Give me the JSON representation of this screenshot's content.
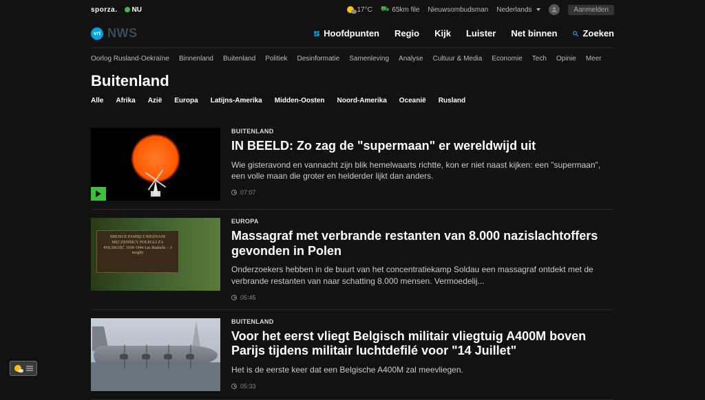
{
  "topbar": {
    "brand1": "sporza.",
    "brand2": "NU",
    "weather_temp": "17°C",
    "traffic": "65km file",
    "ombudsman": "Nieuwsombudsman",
    "language": "Nederlands",
    "login": "Aanmelden"
  },
  "logo": {
    "badge": "vrt",
    "text": "NWS"
  },
  "mainnav": [
    "Hoofdpunten",
    "Regio",
    "Kijk",
    "Luister",
    "Net binnen",
    "Zoeken"
  ],
  "categories": [
    "Oorlog Rusland-Oekraïne",
    "Binnenland",
    "Buitenland",
    "Politiek",
    "Desinformatie",
    "Samenleving",
    "Analyse",
    "Cultuur & Media",
    "Economie",
    "Tech",
    "Opinie",
    "Meer"
  ],
  "page_title": "Buitenland",
  "filters": [
    "Alle",
    "Afrika",
    "Azië",
    "Europa",
    "Latijns-Amerika",
    "Midden-Oosten",
    "Noord-Amerika",
    "Oceanië",
    "Rusland"
  ],
  "articles": [
    {
      "kicker": "BUITENLAND",
      "headline": "IN BEELD: Zo zag de \"supermaan\" er wereldwijd uit",
      "dek": "Wie gisteravond en vannacht zijn blik hemelwaarts richtte, kon er niet naast kijken: een \"supermaan\", een volle maan die groter en helderder lijkt dan anders.",
      "time": "07:07",
      "has_video": true,
      "thumb": "moon",
      "plaque": ""
    },
    {
      "kicker": "EUROPA",
      "headline": "Massagraf met verbrande restanten van 8.000 nazislachtoffers gevonden in Polen",
      "dek": "Onderzoekers hebben in de buurt van het concentratiekamp Soldau een massagraf ontdekt met de verbrande restanten van naar schatting 8.000 mensen. Vermoedelij...",
      "time": "05:45",
      "has_video": false,
      "thumb": "forest",
      "plaque": "MIEJSCE PAMIĘCI\nNIEZNANI MĘCZENNICY\nPOLEGLI ZA POLSKOŚĆ\n1939-1944\nLas Białucki – 3 mogiły"
    },
    {
      "kicker": "BUITENLAND",
      "headline": "Voor het eerst vliegt Belgisch militair vliegtuig A400M boven Parijs tijdens militair luchtdefilé voor \"14 Juillet\"",
      "dek": "Het is de eerste keer dat een Belgische A400M zal meevliegen.",
      "time": "05:33",
      "has_video": false,
      "thumb": "plane",
      "plaque": ""
    }
  ]
}
